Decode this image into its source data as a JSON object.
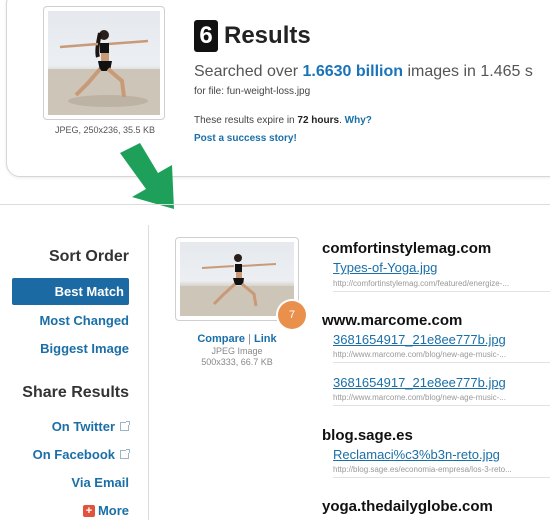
{
  "query": {
    "image_meta": "JPEG, 250x236, 35.5 KB",
    "results_count": "6",
    "results_label": "Results",
    "searched_prefix": "Searched over ",
    "searched_highlight": "1.6630 billion",
    "searched_suffix": " images in 1.465 s",
    "for_file": "for file: fun-weight-loss.jpg",
    "expire_prefix": "These results expire in ",
    "expire_bold": "72 hours",
    "expire_period": ".",
    "expire_link": "Why?",
    "success_link": "Post a success story!"
  },
  "sidebar": {
    "sort_heading": "Sort Order",
    "sort_items": [
      "Best Match",
      "Most Changed",
      "Biggest Image"
    ],
    "share_heading": "Share Results",
    "share_items": [
      "On Twitter",
      "On Facebook",
      "Via Email",
      "More"
    ]
  },
  "match": {
    "rank": "7",
    "compare": "Compare",
    "sep": "|",
    "link": "Link",
    "type": "JPEG Image",
    "meta": "500x333, 66.7 KB",
    "sites": [
      {
        "domain": "comfortinstylemag.com",
        "files": [
          {
            "name": "Types-of-Yoga.jpg",
            "url": "http://comfortinstylemag.com/featured/energize-..."
          }
        ]
      },
      {
        "domain": "www.marcome.com",
        "files": [
          {
            "name": "3681654917_21e8ee777b.jpg",
            "url": "http://www.marcome.com/blog/new-age-music-..."
          },
          {
            "name": "3681654917_21e8ee777b.jpg",
            "url": "http://www.marcome.com/blog/new-age-music-..."
          }
        ]
      },
      {
        "domain": "blog.sage.es",
        "files": [
          {
            "name": "Reclamaci%c3%b3n-reto.jpg",
            "url": "http://blog.sage.es/economia-empresa/los-3-reto..."
          }
        ]
      },
      {
        "domain": "yoga.thedailyglobe.com",
        "files": []
      }
    ]
  },
  "colors": {
    "link": "#1a6fa8",
    "active_bg": "#1c6aa3",
    "badge": "#e8904c",
    "arrow": "#1fa05a"
  }
}
